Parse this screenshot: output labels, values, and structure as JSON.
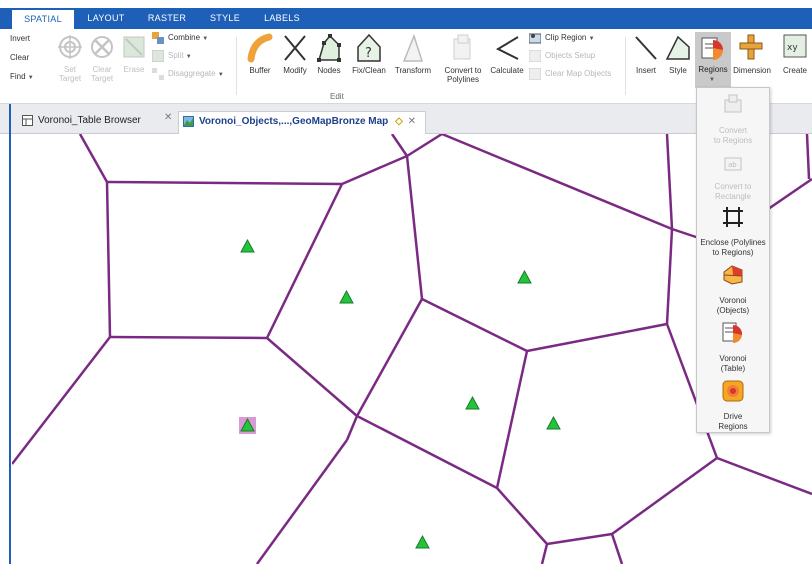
{
  "ribbon_tabs": [
    {
      "label": "SPATIAL",
      "active": true
    },
    {
      "label": "LAYOUT",
      "active": false
    },
    {
      "label": "RASTER",
      "active": false
    },
    {
      "label": "STYLE",
      "active": false
    },
    {
      "label": "LABELS",
      "active": false
    }
  ],
  "selection_group": {
    "invert": "Invert",
    "clear": "Clear",
    "find": "Find"
  },
  "target_group": {
    "set_target": "Set\nTarget",
    "clear_target": "Clear\nTarget",
    "erase": "Erase",
    "combine": "Combine",
    "split": "Split",
    "disaggregate": "Disaggregate"
  },
  "edit_buttons": [
    {
      "label": "Buffer",
      "icon": "buffer-icon"
    },
    {
      "label": "Modify",
      "icon": "modify-icon"
    },
    {
      "label": "Nodes",
      "icon": "nodes-icon"
    },
    {
      "label": "Fix/Clean",
      "icon": "fix-clean-icon"
    },
    {
      "label": "Transform",
      "icon": "transform-icon"
    },
    {
      "label": "Convert to\nPolylines",
      "icon": "convert-to-polylines-icon"
    },
    {
      "label": "Calculate",
      "icon": "calculate-icon"
    }
  ],
  "clip_group": {
    "clip_region": "Clip Region",
    "objects_setup": "Objects Setup",
    "clear_map_objects": "Clear Map Objects"
  },
  "edit_group_label": "Edit",
  "right_buttons": [
    {
      "label": "Insert",
      "icon": "insert-icon"
    },
    {
      "label": "Style",
      "icon": "style-icon"
    },
    {
      "label": "Regions",
      "icon": "regions-icon",
      "active": true
    },
    {
      "label": "Dimension",
      "icon": "dimension-icon"
    },
    {
      "label": "Create",
      "icon": "create-icon"
    }
  ],
  "doc_tabs": [
    {
      "label": "Voronoi_Table Browser",
      "active": false
    },
    {
      "label": "Voronoi_Objects,...,GeoMapBronze Map",
      "active": true
    }
  ],
  "regions_menu": [
    {
      "label": "Convert\nto Regions",
      "enabled": false,
      "icon": "convert-to-regions-icon"
    },
    {
      "label": "Convert to\nRectangle",
      "enabled": false,
      "icon": "convert-to-rectangle-icon"
    },
    {
      "label": "Enclose (Polylines\nto Regions)",
      "enabled": true,
      "icon": "enclose-icon"
    },
    {
      "label": "Voronoi\n(Objects)",
      "enabled": true,
      "icon": "voronoi-objects-icon"
    },
    {
      "label": "Voronoi\n(Table)",
      "enabled": true,
      "icon": "voronoi-table-icon"
    },
    {
      "label": "Drive\nRegions",
      "enabled": true,
      "icon": "drive-regions-icon"
    }
  ],
  "colors": {
    "ribbon_blue": "#1e5fb8",
    "voronoi_edge": "#7b2a84",
    "point_fill": "#22c43a",
    "selected_point_bg": "#d79ad6"
  }
}
